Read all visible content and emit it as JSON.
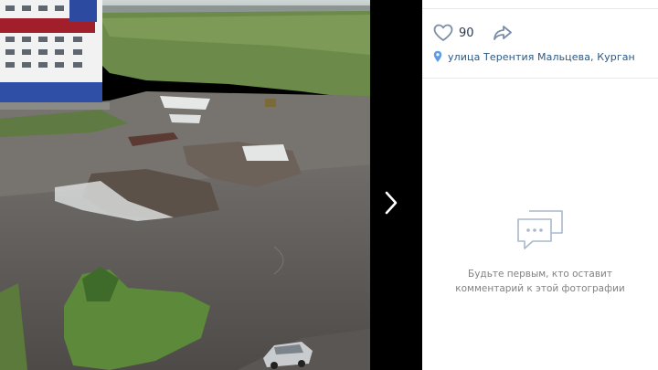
{
  "post": {
    "likes": "90",
    "location": "улица Терентия Мальцева, Курган"
  },
  "comments": {
    "empty_text": "Будьте первым, кто оставит\nкомментарий к этой фотографии"
  },
  "icons": {
    "like": "heart-icon",
    "share": "share-arrow-icon",
    "location": "map-pin-icon",
    "next": "chevron-right-icon",
    "comments": "speech-bubbles-icon"
  },
  "colors": {
    "link": "#2a5885",
    "icon": "#7b8ea6",
    "muted": "#828282",
    "pin": "#5c9ce6"
  }
}
